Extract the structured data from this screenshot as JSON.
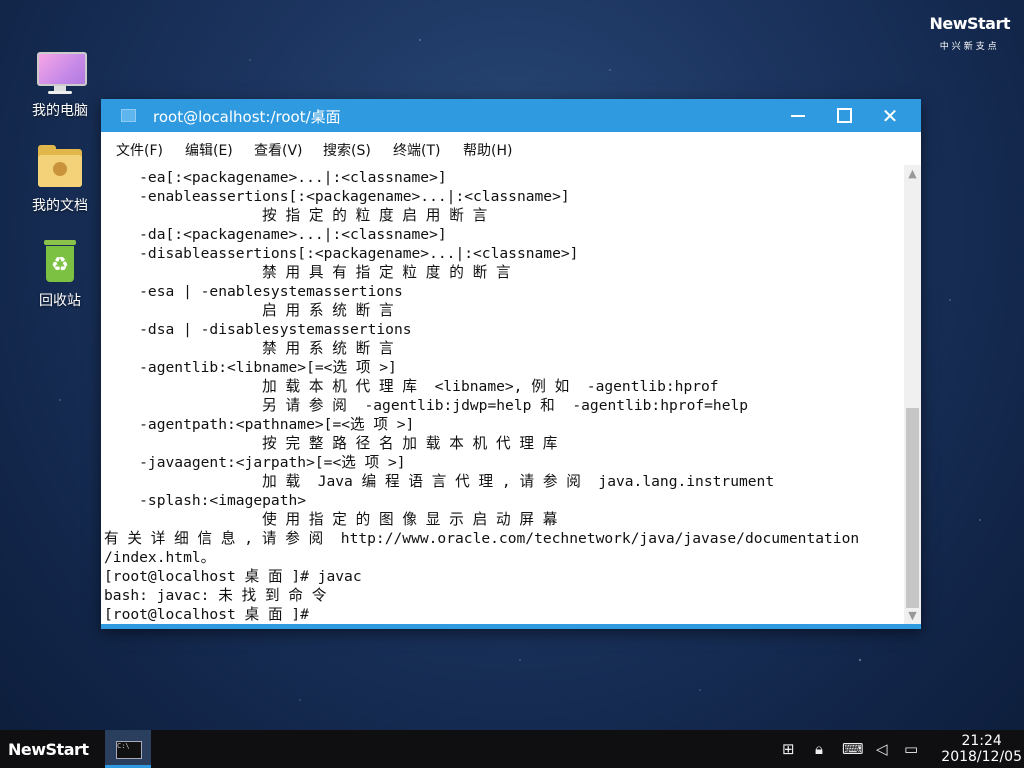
{
  "brand": {
    "logo": "NewStart",
    "subtitle": "中兴新支点"
  },
  "desktop": {
    "icons": [
      {
        "label": "我的电脑"
      },
      {
        "label": "我的文档"
      },
      {
        "label": "回收站"
      }
    ]
  },
  "window": {
    "title": "root@localhost:/root/桌面",
    "menu": [
      "文件(F)",
      "编辑(E)",
      "查看(V)",
      "搜索(S)",
      "终端(T)",
      "帮助(H)"
    ],
    "terminal_lines": [
      "    -ea[:<packagename>...|:<classname>]",
      "    -enableassertions[:<packagename>...|:<classname>]",
      "                  按 指 定 的 粒 度 启 用 断 言",
      "    -da[:<packagename>...|:<classname>]",
      "    -disableassertions[:<packagename>...|:<classname>]",
      "                  禁 用 具 有 指 定 粒 度 的 断 言",
      "    -esa | -enablesystemassertions",
      "                  启 用 系 统 断 言",
      "    -dsa | -disablesystemassertions",
      "                  禁 用 系 统 断 言",
      "    -agentlib:<libname>[=<选 项 >]",
      "                  加 载 本 机 代 理 库  <libname>, 例 如  -agentlib:hprof",
      "                  另 请 参 阅  -agentlib:jdwp=help 和  -agentlib:hprof=help",
      "    -agentpath:<pathname>[=<选 项 >]",
      "                  按 完 整 路 径 名 加 载 本 机 代 理 库",
      "    -javaagent:<jarpath>[=<选 项 >]",
      "                  加 载  Java 编 程 语 言 代 理 , 请 参 阅  java.lang.instrument",
      "    -splash:<imagepath>",
      "                  使 用 指 定 的 图 像 显 示 启 动 屏 幕",
      "有 关 详 细 信 息 , 请 参 阅  http://www.oracle.com/technetwork/java/javase/documentation",
      "/index.html。",
      "[root@localhost 桌 面 ]# javac",
      "bash: javac: 未 找 到 命 令",
      "[root@localhost 桌 面 ]#"
    ]
  },
  "taskbar": {
    "logo": "NewStart",
    "app_icon_text": "C:\\",
    "tray_icons": [
      "network-icon",
      "lock-icon",
      "keyboard-icon",
      "volume-icon",
      "display-icon"
    ],
    "time": "21:24",
    "date": "2018/12/05"
  },
  "colors": {
    "titlebar": "#2f9ae0",
    "taskbar": "#0f0f12"
  }
}
